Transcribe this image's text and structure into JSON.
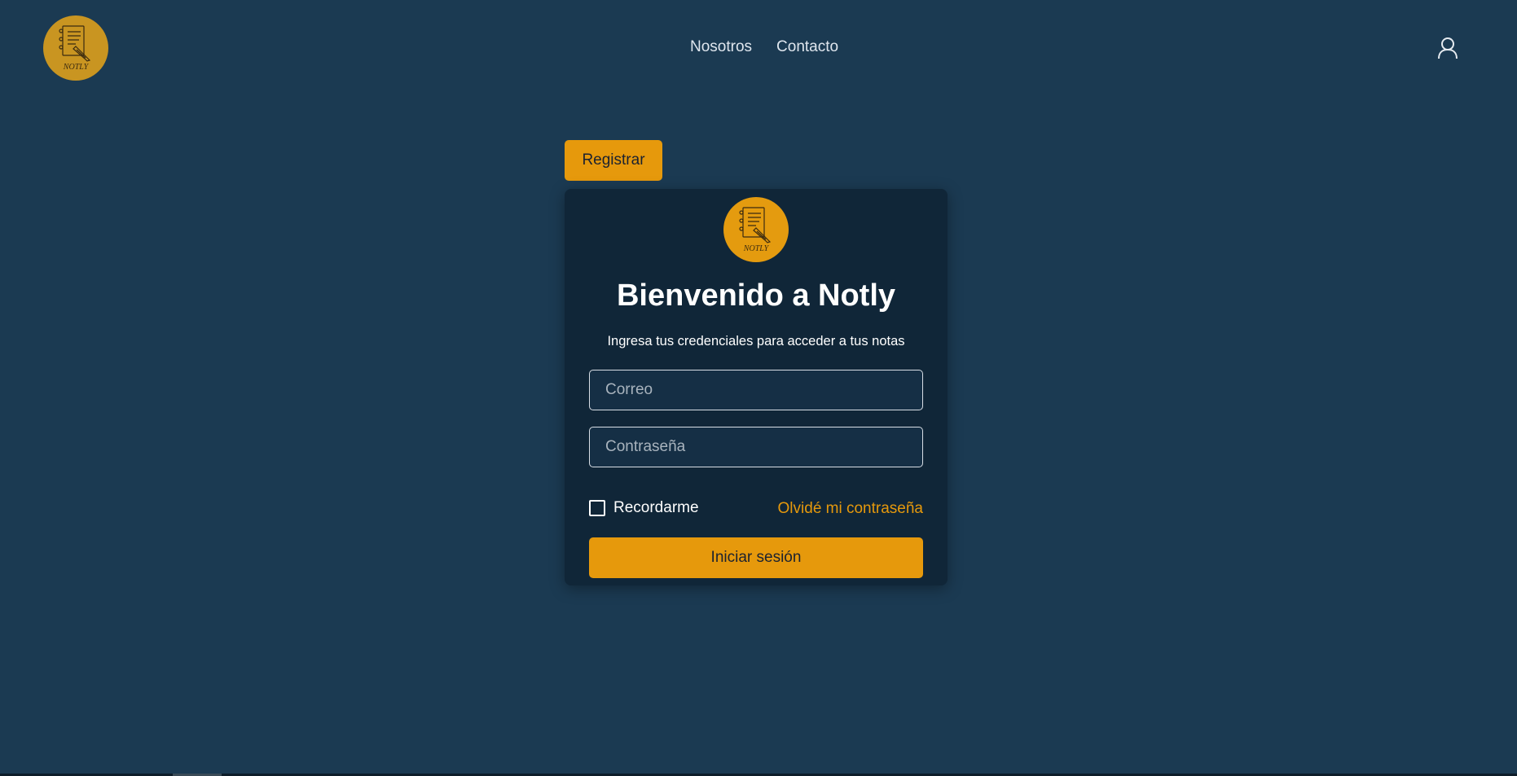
{
  "header": {
    "logo_text": "NOTLY",
    "nav": [
      {
        "label": "Nosotros"
      },
      {
        "label": "Contacto"
      }
    ],
    "user_icon": "user-icon"
  },
  "register_label": "Registrar",
  "login": {
    "logo_text": "NOTLY",
    "title": "Bienvenido a Notly",
    "subtitle": "Ingresa tus credenciales para acceder a tus notas",
    "email_placeholder": "Correo",
    "password_placeholder": "Contraseña",
    "remember_label": "Recordarme",
    "remember_checked": false,
    "forgot_label": "Olvidé mi contraseña",
    "submit_label": "Iniciar sesión"
  },
  "colors": {
    "background": "#1b3a52",
    "card": "#102638",
    "accent": "#e6990c"
  }
}
